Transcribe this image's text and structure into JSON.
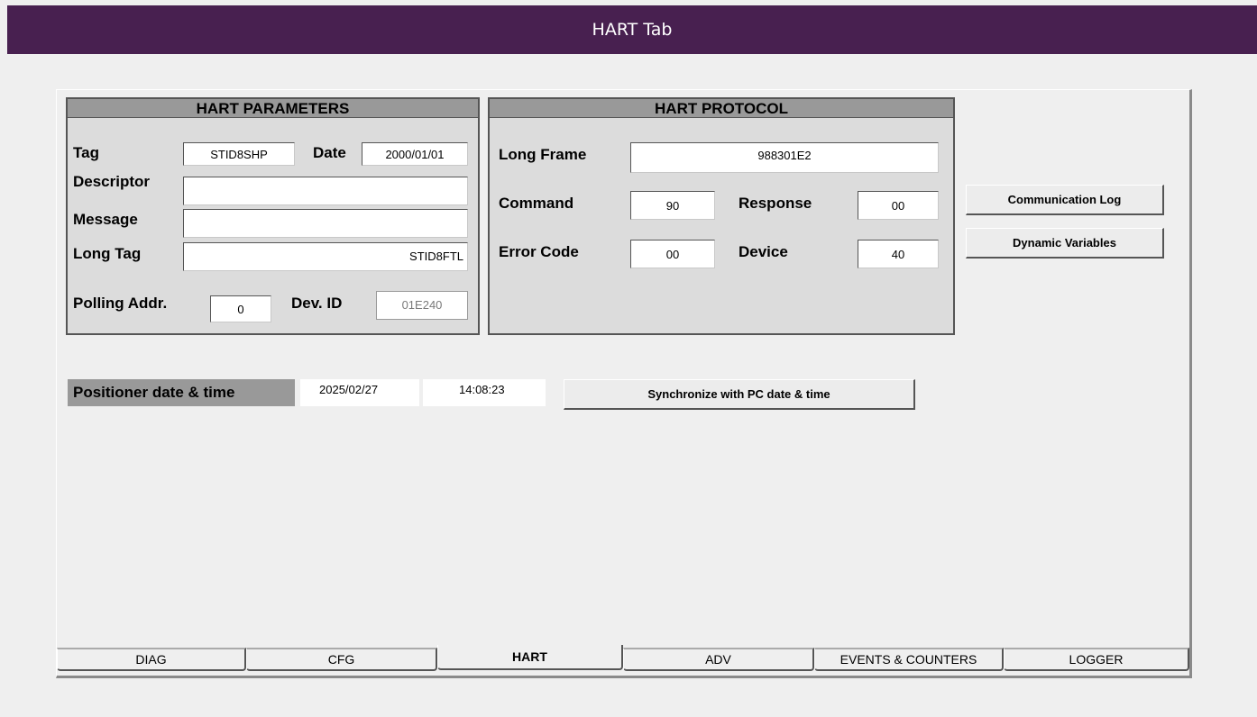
{
  "banner": {
    "title": "HART Tab"
  },
  "hart_parameters": {
    "title": "HART PARAMETERS",
    "tag_label": "Tag",
    "tag_value": "STID8SHP",
    "date_label": "Date",
    "date_value": "2000/01/01",
    "descriptor_label": "Descriptor",
    "descriptor_value": "",
    "message_label": "Message",
    "message_value": "",
    "long_tag_label": "Long Tag",
    "long_tag_value": "STID8FTL",
    "polling_label": "Polling Addr.",
    "polling_value": "0",
    "devid_label": "Dev. ID",
    "devid_value": "01E240"
  },
  "hart_protocol": {
    "title": "HART PROTOCOL",
    "long_frame_label": "Long Frame",
    "long_frame_value": "988301E2",
    "command_label": "Command",
    "command_value": "90",
    "response_label": "Response",
    "response_value": "00",
    "error_label": "Error Code",
    "error_value": "00",
    "device_label": "Device",
    "device_value": "40"
  },
  "side_buttons": {
    "comm_log": "Communication Log",
    "dyn_vars": "Dynamic Variables"
  },
  "datetime": {
    "label": "Positioner date & time",
    "date": "2025/02/27",
    "time": "14:08:23",
    "sync_button": "Synchronize with PC date & time"
  },
  "tabs": [
    "DIAG",
    "CFG",
    "HART",
    "ADV",
    "EVENTS & COUNTERS",
    "LOGGER"
  ],
  "active_tab": "HART"
}
